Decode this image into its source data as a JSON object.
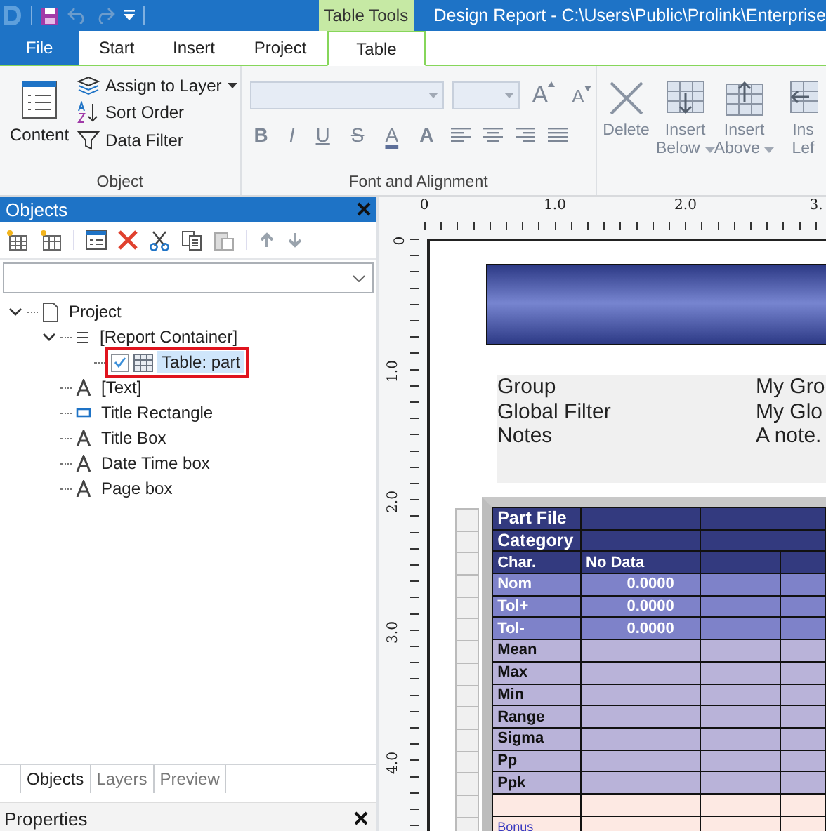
{
  "window": {
    "title": "Design Report - C:\\Users\\Public\\Prolink\\Enterprise"
  },
  "context_tab": {
    "label": "Table Tools"
  },
  "ribbon_tabs": [
    {
      "label": "File",
      "kind": "file",
      "selected": false
    },
    {
      "label": "Start",
      "kind": "tab",
      "selected": false
    },
    {
      "label": "Insert",
      "kind": "tab",
      "selected": false
    },
    {
      "label": "Project",
      "kind": "tab",
      "selected": false
    },
    {
      "label": "Table",
      "kind": "tab",
      "selected": true
    }
  ],
  "object_group": {
    "label": "Object",
    "content_button": "Content",
    "buttons": [
      {
        "label": "Assign to Layer",
        "kind": "layer",
        "dropdown": true
      },
      {
        "label": "Sort Order",
        "kind": "sort",
        "dropdown": false
      },
      {
        "label": "Data Filter",
        "kind": "filter",
        "dropdown": false
      }
    ]
  },
  "font_group": {
    "label": "Font and Alignment",
    "size_buttons": [
      {
        "label": "A",
        "kind": "grow"
      },
      {
        "label": "A",
        "kind": "shrink"
      }
    ],
    "format_buttons": [
      {
        "label": "B",
        "kind": "bold"
      },
      {
        "label": "I",
        "kind": "italic"
      },
      {
        "label": "U",
        "kind": "underline"
      },
      {
        "label": "S",
        "kind": "strike"
      },
      {
        "label": "A",
        "kind": "color"
      },
      {
        "label": "A",
        "kind": "highlight"
      }
    ],
    "disabled": true
  },
  "table_group": {
    "buttons": [
      {
        "lines": [
          "Delete"
        ],
        "kind": "delete",
        "dropdown": false,
        "disabled": true
      },
      {
        "lines": [
          "Insert",
          "Below"
        ],
        "kind": "below",
        "dropdown": true,
        "disabled": true
      },
      {
        "lines": [
          "Insert",
          "Above"
        ],
        "kind": "above",
        "dropdown": true,
        "disabled": true
      },
      {
        "lines": [
          "Ins",
          "Lef"
        ],
        "kind": "left",
        "dropdown": false,
        "disabled": true
      }
    ]
  },
  "objects_panel": {
    "title": "Objects",
    "tree": [
      {
        "label": "Project",
        "kind": "page",
        "expanded": true,
        "selected": false,
        "children": [
          {
            "label": "[Report Container]",
            "kind": "list",
            "expanded": true,
            "selected": false,
            "children": [
              {
                "label": "Table: part",
                "kind": "table",
                "checked": true,
                "selected": true
              }
            ]
          },
          {
            "label": "[Text]",
            "kind": "text",
            "selected": false
          },
          {
            "label": "Title Rectangle",
            "kind": "rect",
            "selected": false
          },
          {
            "label": "Title Box",
            "kind": "text",
            "selected": false
          },
          {
            "label": "Date Time box",
            "kind": "text",
            "selected": false
          },
          {
            "label": "Page box",
            "kind": "text",
            "selected": false
          }
        ]
      }
    ],
    "tabs": [
      {
        "label": "Objects",
        "selected": true
      },
      {
        "label": "Layers",
        "selected": false
      },
      {
        "label": "Preview",
        "selected": false
      }
    ]
  },
  "properties_panel": {
    "title": "Properties"
  },
  "ruler": {
    "horizontal": [
      "0",
      "1.0",
      "2.0",
      "3."
    ],
    "vertical": [
      "0",
      "1.0",
      "2.0",
      "3.0",
      "4.0"
    ]
  },
  "report": {
    "info": [
      {
        "label": "Group",
        "value": "My Gro"
      },
      {
        "label": "Global Filter",
        "value": "My Glo"
      },
      {
        "label": "Notes",
        "value": "A note."
      }
    ],
    "rows": [
      {
        "kind": "title",
        "label": "Part File"
      },
      {
        "kind": "title",
        "label": "Category"
      },
      {
        "kind": "header",
        "label": "Char.",
        "cells": [
          "No Data"
        ]
      },
      {
        "kind": "spec",
        "label": "Nom",
        "cells": [
          "0.0000"
        ]
      },
      {
        "kind": "spec",
        "label": "Tol+",
        "cells": [
          "0.0000"
        ]
      },
      {
        "kind": "spec",
        "label": "Tol-",
        "cells": [
          "0.0000"
        ]
      },
      {
        "kind": "stat",
        "label": "Mean"
      },
      {
        "kind": "stat",
        "label": "Max"
      },
      {
        "kind": "stat",
        "label": "Min"
      },
      {
        "kind": "stat",
        "label": "Range"
      },
      {
        "kind": "stat",
        "label": "Sigma"
      },
      {
        "kind": "stat",
        "label": "Pp"
      },
      {
        "kind": "stat",
        "label": "Ppk"
      },
      {
        "kind": "blank"
      },
      {
        "kind": "bonus",
        "label": "Bonus"
      }
    ]
  }
}
